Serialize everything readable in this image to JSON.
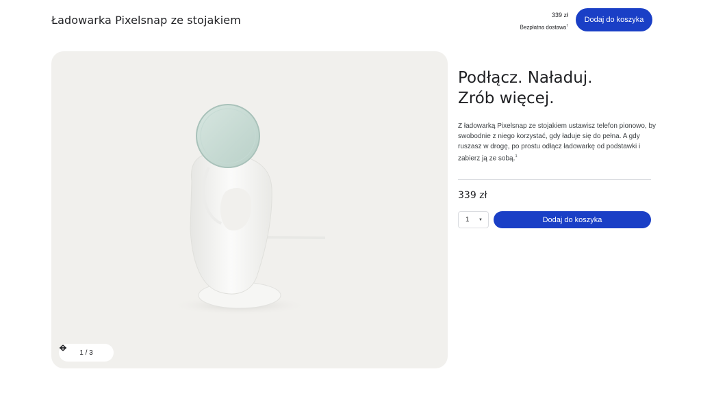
{
  "header": {
    "title": "Ładowarka Pixelsnap ze stojakiem",
    "price": "339 zł",
    "shipping": "Bezpłatna dostawa",
    "shipping_footnote": "†",
    "cart_button": "Dodaj do koszyka"
  },
  "gallery": {
    "counter": "1 / 3",
    "prev_icon": "arrow-left-icon",
    "next_icon": "arrow-right-icon"
  },
  "main": {
    "headline_line1": "Podłącz. Naładuj.",
    "headline_line2": "Zrób więcej.",
    "description": "Z ładowarką Pixelsnap ze stojakiem ustawisz telefon pionowo, by swobodnie z niego korzystać, gdy ładuje się do pełna. A gdy ruszasz w drogę, po prostu odłącz ładowarkę od podstawki i zabierz ją ze sobą.",
    "description_footnote": "1",
    "price": "339 zł",
    "quantity": "1",
    "cart_button": "Dodaj do koszyka"
  },
  "colors": {
    "accent": "#1a3fc6",
    "gallery_bg": "#f1f0ed"
  }
}
